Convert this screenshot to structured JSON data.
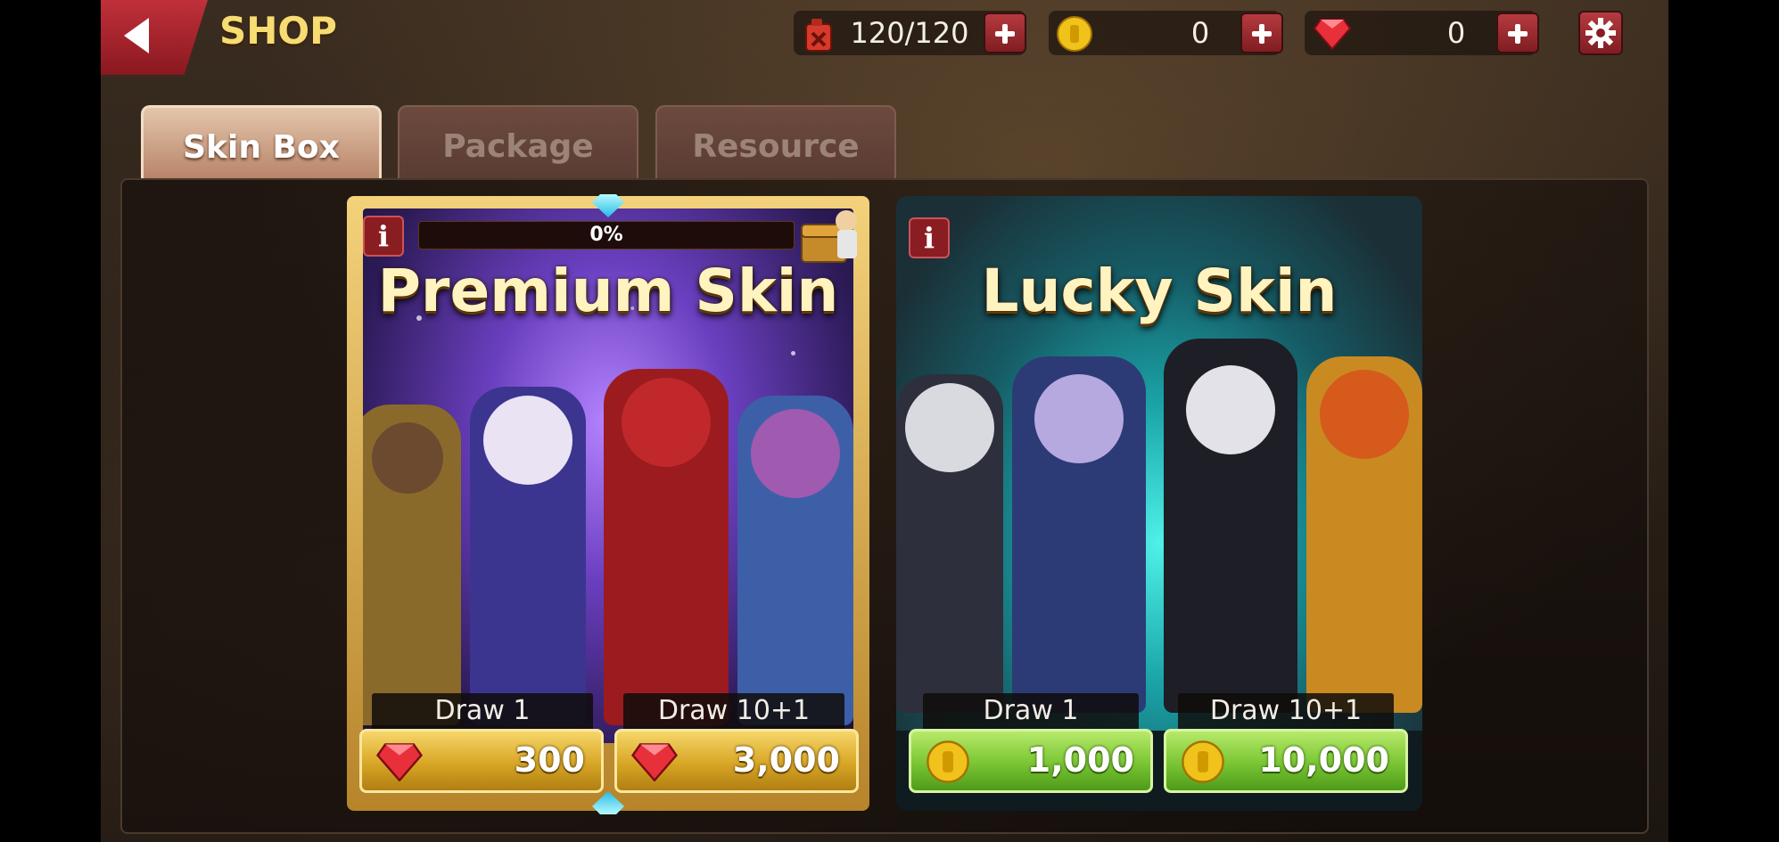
{
  "header": {
    "title": "SHOP",
    "stamina": "120/120",
    "coins": "0",
    "gems": "0"
  },
  "tabs": [
    {
      "label": "Skin Box",
      "active": true
    },
    {
      "label": "Package",
      "active": false
    },
    {
      "label": "Resource",
      "active": false
    }
  ],
  "cards": [
    {
      "title": "Premium Skin",
      "progress_text": "0%",
      "progress_value": 0,
      "draw_one_label": "Draw 1",
      "draw_one_price": "300",
      "draw_ten_label": "Draw 10+1",
      "draw_ten_price": "3,000",
      "currency": "gem-icon"
    },
    {
      "title": "Lucky Skin",
      "draw_one_label": "Draw 1",
      "draw_one_price": "1,000",
      "draw_ten_label": "Draw 10+1",
      "draw_ten_price": "10,000",
      "currency": "coin-icon"
    }
  ],
  "colors": {
    "accent_red": "#8a1d22",
    "title_gold": "#f6dc73",
    "gold_button": "#d8a625",
    "green_button": "#79c533"
  }
}
